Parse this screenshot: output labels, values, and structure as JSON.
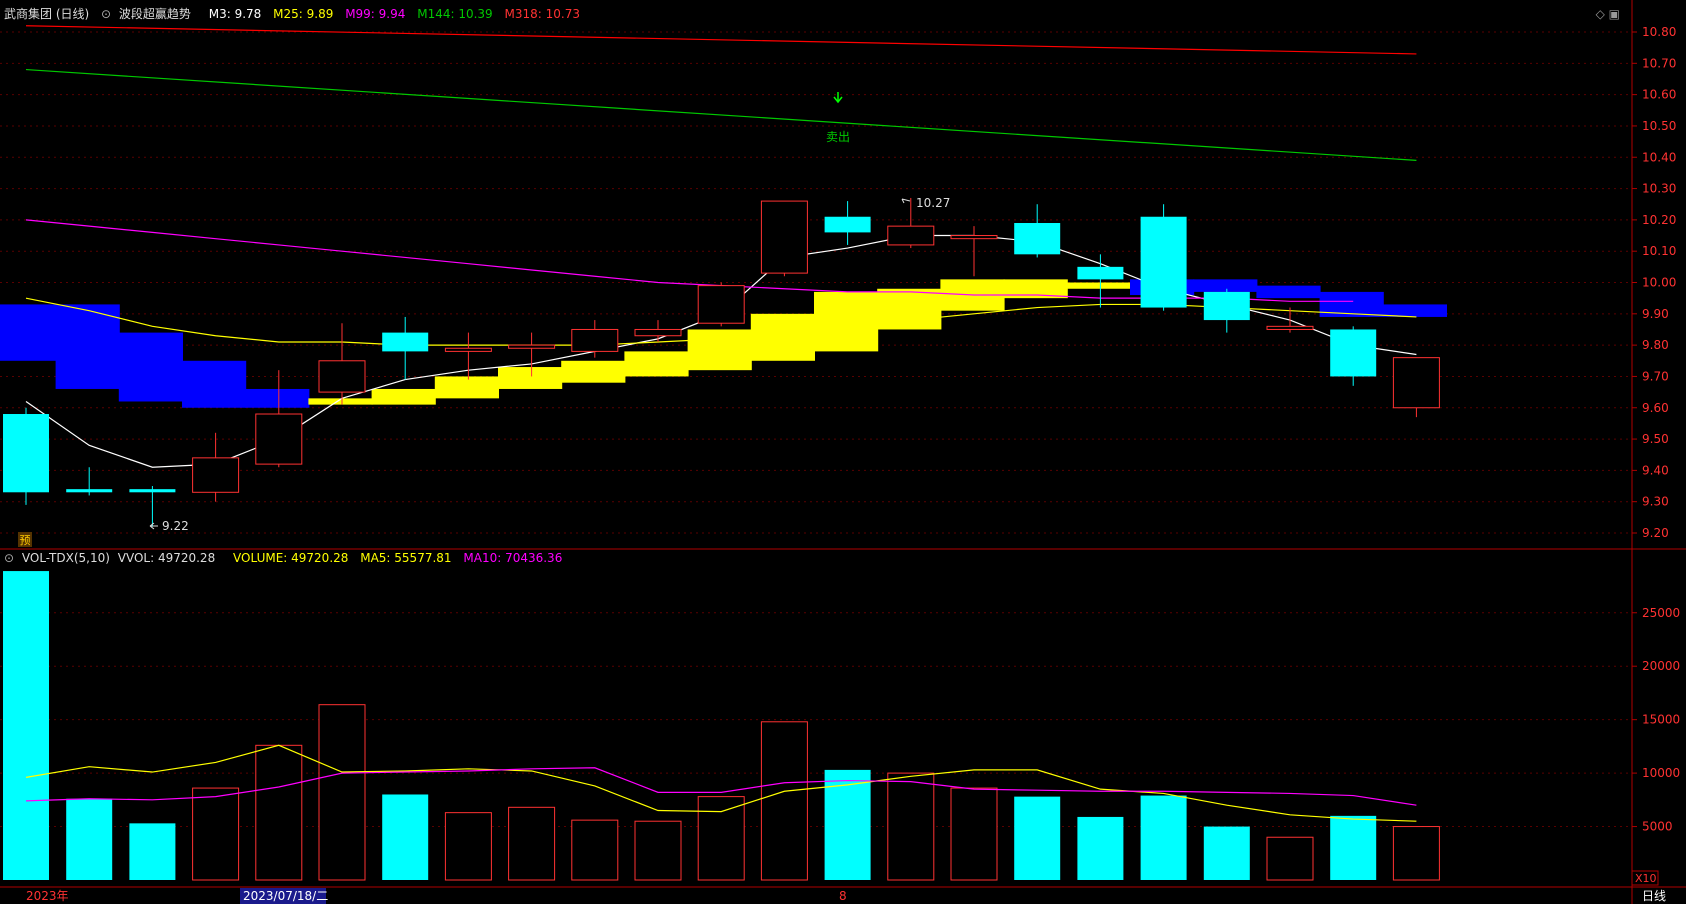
{
  "price_header": {
    "title": "武商集团 (日线)",
    "formula_icon": "⊙",
    "indicator": "波段超赢趋势",
    "m3": "M3: 9.78",
    "m25": "M25: 9.89",
    "m99": "M99: 9.94",
    "m144": "M144: 10.39",
    "m318": "M318: 10.73"
  },
  "volume_header": {
    "indicator": "VOL-TDX(5,10)",
    "vvol": "VVOL: 49720.28",
    "volume": "VOLUME: 49720.28",
    "ma5": "MA5: 55577.81",
    "ma10": "MA10: 70436.36"
  },
  "annotations": {
    "sell": "卖出",
    "high_label": "10.27",
    "low_label": "9.22",
    "pre_marker": "预"
  },
  "bottom_bar": {
    "year": "2023年",
    "date_highlight": "2023/07/18/二",
    "month": "8",
    "period": "日线",
    "vol_multiplier": "X10"
  },
  "colors": {
    "up": "#ff3232",
    "down": "#00ffff",
    "m3": "#ffffff",
    "m25": "#ffff00",
    "m99": "#ff00ff",
    "m144": "#00c800",
    "m318": "#ff0000",
    "band_up": "#ffff00",
    "band_down": "#0000ff",
    "ma5": "#ffff00",
    "ma10": "#ff00ff"
  },
  "chart_data": [
    {
      "type": "candlestick",
      "ylim": [
        9.2,
        10.85
      ],
      "y_ticks": [
        9.2,
        9.3,
        9.4,
        9.5,
        9.6,
        9.7,
        9.8,
        9.9,
        10.0,
        10.1,
        10.2,
        10.3,
        10.4,
        10.5,
        10.6,
        10.7,
        10.8
      ],
      "candles": [
        {
          "o": 9.58,
          "h": 9.6,
          "l": 9.29,
          "c": 9.33
        },
        {
          "o": 9.34,
          "h": 9.41,
          "l": 9.32,
          "c": 9.33
        },
        {
          "o": 9.34,
          "h": 9.35,
          "l": 9.22,
          "c": 9.33
        },
        {
          "o": 9.33,
          "h": 9.52,
          "l": 9.3,
          "c": 9.44
        },
        {
          "o": 9.42,
          "h": 9.72,
          "l": 9.41,
          "c": 9.58
        },
        {
          "o": 9.65,
          "h": 9.87,
          "l": 9.61,
          "c": 9.75
        },
        {
          "o": 9.84,
          "h": 9.89,
          "l": 9.69,
          "c": 9.78
        },
        {
          "o": 9.78,
          "h": 9.84,
          "l": 9.69,
          "c": 9.79
        },
        {
          "o": 9.79,
          "h": 9.84,
          "l": 9.7,
          "c": 9.8
        },
        {
          "o": 9.78,
          "h": 9.88,
          "l": 9.76,
          "c": 9.85
        },
        {
          "o": 9.83,
          "h": 9.88,
          "l": 9.81,
          "c": 9.85
        },
        {
          "o": 9.87,
          "h": 10.0,
          "l": 9.86,
          "c": 9.99
        },
        {
          "o": 10.03,
          "h": 10.26,
          "l": 10.02,
          "c": 10.26
        },
        {
          "o": 10.21,
          "h": 10.26,
          "l": 10.12,
          "c": 10.16
        },
        {
          "o": 10.12,
          "h": 10.27,
          "l": 10.11,
          "c": 10.18
        },
        {
          "o": 10.14,
          "h": 10.18,
          "l": 10.02,
          "c": 10.15
        },
        {
          "o": 10.19,
          "h": 10.25,
          "l": 10.08,
          "c": 10.09
        },
        {
          "o": 10.05,
          "h": 10.09,
          "l": 9.92,
          "c": 10.01
        },
        {
          "o": 10.21,
          "h": 10.25,
          "l": 9.91,
          "c": 9.92
        },
        {
          "o": 9.97,
          "h": 9.98,
          "l": 9.84,
          "c": 9.88
        },
        {
          "o": 9.85,
          "h": 9.92,
          "l": 9.84,
          "c": 9.86
        },
        {
          "o": 9.85,
          "h": 9.86,
          "l": 9.67,
          "c": 9.7
        },
        {
          "o": 9.6,
          "h": 9.76,
          "l": 9.57,
          "c": 9.76
        }
      ],
      "series": [
        {
          "name": "M3",
          "values": [
            9.62,
            9.48,
            9.41,
            9.42,
            9.5,
            9.63,
            9.69,
            9.72,
            9.74,
            9.78,
            9.82,
            9.9,
            10.08,
            10.11,
            10.15,
            10.15,
            10.13,
            10.06,
            9.98,
            9.93,
            9.88,
            9.8,
            9.77
          ]
        },
        {
          "name": "M25",
          "values": [
            9.95,
            9.91,
            9.86,
            9.83,
            9.81,
            9.81,
            9.8,
            9.8,
            9.8,
            9.8,
            9.81,
            9.82,
            9.84,
            9.86,
            9.88,
            9.9,
            9.92,
            9.93,
            9.93,
            9.92,
            9.91,
            9.9,
            9.89
          ]
        },
        {
          "name": "M99",
          "values": [
            10.2,
            10.18,
            10.16,
            10.14,
            10.12,
            10.1,
            10.08,
            10.06,
            10.04,
            10.02,
            10.0,
            9.99,
            9.98,
            9.97,
            9.97,
            9.96,
            9.96,
            9.95,
            9.95,
            9.95,
            9.94,
            9.94
          ]
        },
        {
          "name": "M144",
          "values": [
            10.68,
            10.39
          ]
        },
        {
          "name": "M318",
          "values": [
            10.82,
            10.73
          ]
        }
      ],
      "band": [
        {
          "top": 9.93,
          "bottom": 9.75,
          "up": false
        },
        {
          "top": 9.93,
          "bottom": 9.66,
          "up": false
        },
        {
          "top": 9.84,
          "bottom": 9.62,
          "up": false
        },
        {
          "top": 9.75,
          "bottom": 9.6,
          "up": false
        },
        {
          "top": 9.66,
          "bottom": 9.6,
          "up": false
        },
        {
          "top": 9.63,
          "bottom": 9.61,
          "up": true
        },
        {
          "top": 9.66,
          "bottom": 9.61,
          "up": true
        },
        {
          "top": 9.7,
          "bottom": 9.63,
          "up": true
        },
        {
          "top": 9.73,
          "bottom": 9.66,
          "up": true
        },
        {
          "top": 9.75,
          "bottom": 9.68,
          "up": true
        },
        {
          "top": 9.78,
          "bottom": 9.7,
          "up": true
        },
        {
          "top": 9.85,
          "bottom": 9.72,
          "up": true
        },
        {
          "top": 9.9,
          "bottom": 9.75,
          "up": true
        },
        {
          "top": 9.97,
          "bottom": 9.78,
          "up": true
        },
        {
          "top": 9.98,
          "bottom": 9.85,
          "up": true
        },
        {
          "top": 10.01,
          "bottom": 9.91,
          "up": true
        },
        {
          "top": 10.01,
          "bottom": 9.95,
          "up": true
        },
        {
          "top": 10.0,
          "bottom": 9.98,
          "up": true
        },
        {
          "top": 10.01,
          "bottom": 9.96,
          "up": false
        },
        {
          "top": 10.01,
          "bottom": 9.97,
          "up": false
        },
        {
          "top": 9.99,
          "bottom": 9.95,
          "up": false
        },
        {
          "top": 9.97,
          "bottom": 9.89,
          "up": false
        },
        {
          "top": 9.93,
          "bottom": 9.89,
          "up": false
        }
      ]
    },
    {
      "type": "bar",
      "ylim": [
        0,
        29000
      ],
      "y_ticks": [
        5000,
        10000,
        15000,
        20000,
        25000
      ],
      "series": [
        {
          "name": "VOLUME",
          "values": [
            28900,
            7600,
            5300,
            8600,
            12600,
            16400,
            8000,
            6300,
            6800,
            5600,
            5500,
            7800,
            14800,
            10300,
            10000,
            8600,
            7800,
            5900,
            7900,
            5000,
            4000,
            6000,
            5000
          ]
        },
        {
          "name": "MA5",
          "values": [
            9600,
            10600,
            10100,
            11000,
            12600,
            10100,
            10200,
            10400,
            10200,
            8800,
            6500,
            6400,
            8300,
            8900,
            9700,
            10300,
            10300,
            8500,
            8100,
            7000,
            6100,
            5700,
            5500
          ]
        },
        {
          "name": "MA10",
          "values": [
            7400,
            7600,
            7500,
            7800,
            8700,
            10000,
            10100,
            10200,
            10400,
            10500,
            8200,
            8200,
            9100,
            9300,
            9200,
            8500,
            8400,
            8300,
            8300,
            8200,
            8100,
            7900,
            7000
          ]
        }
      ]
    }
  ]
}
